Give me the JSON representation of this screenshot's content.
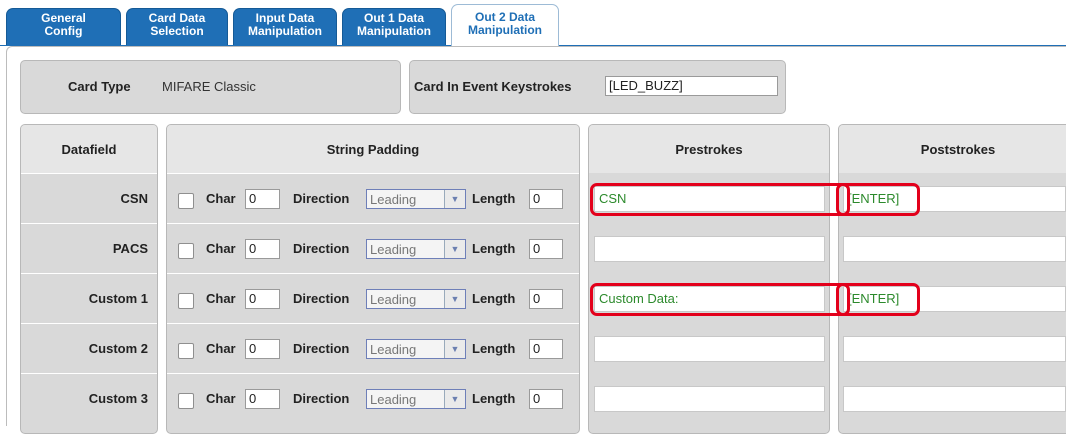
{
  "tabs": [
    {
      "line1": "General",
      "line2": "Config"
    },
    {
      "line1": "Card Data",
      "line2": "Selection"
    },
    {
      "line1": "Input Data",
      "line2": "Manipulation"
    },
    {
      "line1": "Out 1 Data",
      "line2": "Manipulation"
    },
    {
      "line1": "Out 2 Data",
      "line2": "Manipulation",
      "active": true
    }
  ],
  "card_type": {
    "label": "Card Type",
    "value": "MIFARE Classic"
  },
  "card_in_event": {
    "label": "Card In Event Keystrokes",
    "value": "[LED_BUZZ]"
  },
  "headers": {
    "datafield": "Datafield",
    "string_padding": "String Padding",
    "prestrokes": "Prestrokes",
    "poststrokes": "Poststrokes"
  },
  "padding_labels": {
    "char": "Char",
    "direction": "Direction",
    "length": "Length"
  },
  "rows": [
    {
      "name": "CSN",
      "char": "0",
      "direction": "Leading",
      "length": "0",
      "prestrokes": "CSN",
      "poststrokes": "[ENTER]"
    },
    {
      "name": "PACS",
      "char": "0",
      "direction": "Leading",
      "length": "0",
      "prestrokes": "",
      "poststrokes": ""
    },
    {
      "name": "Custom 1",
      "char": "0",
      "direction": "Leading",
      "length": "0",
      "prestrokes": "Custom Data:",
      "poststrokes": "[ENTER]"
    },
    {
      "name": "Custom 2",
      "char": "0",
      "direction": "Leading",
      "length": "0",
      "prestrokes": "",
      "poststrokes": ""
    },
    {
      "name": "Custom 3",
      "char": "0",
      "direction": "Leading",
      "length": "0",
      "prestrokes": "",
      "poststrokes": ""
    }
  ],
  "colors": {
    "tab_blue": "#1f6fb6",
    "prefix_green": "#2c8a2c",
    "highlight_red": "#e3001b"
  }
}
